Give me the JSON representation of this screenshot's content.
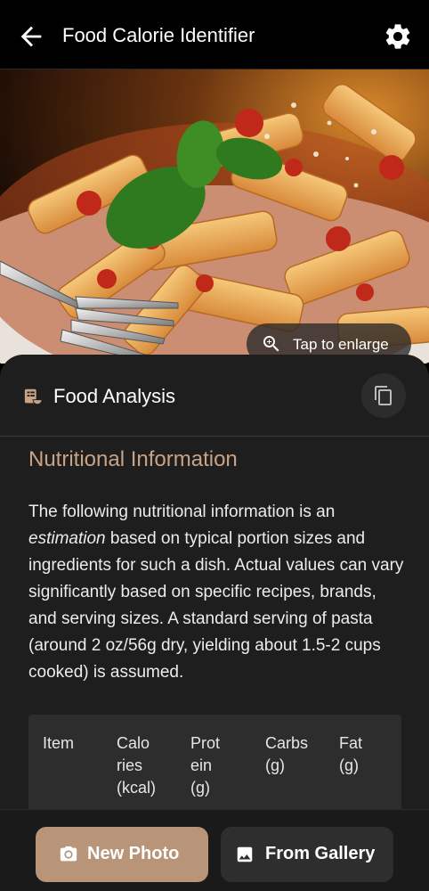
{
  "appbar": {
    "title": "Food Calorie Identifier",
    "back_icon": "arrow-back-icon",
    "settings_icon": "gear-icon"
  },
  "photo": {
    "enlarge_label": "Tap to enlarge",
    "enlarge_icon": "zoom-in-icon"
  },
  "analysis": {
    "title": "Food Analysis",
    "header_icon": "food-menu-icon",
    "copy_icon": "copy-icon",
    "section_title": "Nutritional Information",
    "para_prefix": "The following nutritional information is an ",
    "para_emphasis": "estimation",
    "para_suffix": " based on typical portion sizes and ingredients for such a dish. Actual values can vary significantly based on specific recipes, brands, and serving sizes. A standard serving of pasta (around 2 oz/56g dry, yielding about 1.5-2 cups cooked) is assumed.",
    "table_headers": [
      "Item",
      "Calo\nries\n(kcal)",
      "Prot\nein\n(g)",
      "Carbs\n(g)",
      "Fat\n(g)"
    ]
  },
  "actions": {
    "new_photo": "New Photo",
    "new_photo_icon": "camera-icon",
    "gallery": "From Gallery",
    "gallery_icon": "image-icon"
  },
  "colors": {
    "accent": "#b89578",
    "section_title": "#c9a386",
    "sheet_bg": "#1e1e1e"
  }
}
